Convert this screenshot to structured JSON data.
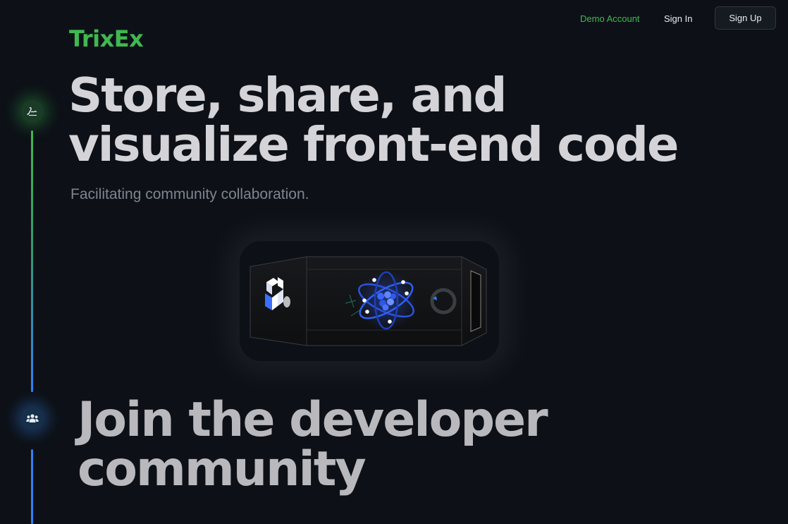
{
  "brand": {
    "name": "TrixEx",
    "color": "#3fb950"
  },
  "nav": {
    "demo_label": "Demo Account",
    "signin_label": "Sign In",
    "signup_label": "Sign Up"
  },
  "hero": {
    "title_line1": "Store, share, and",
    "title_line2": "visualize front-end code",
    "subtitle": "Facilitating community collaboration."
  },
  "timeline": {
    "icons": [
      "signature-icon",
      "users-icon"
    ],
    "colors": {
      "start": "#3fb950",
      "end": "#2f81f7"
    }
  },
  "showcase": {
    "panels": [
      "blocks-logo-icon",
      "react-atom-icon",
      "circle-icon"
    ]
  },
  "community": {
    "title_line1": "Join the developer",
    "title_line2": "community"
  }
}
